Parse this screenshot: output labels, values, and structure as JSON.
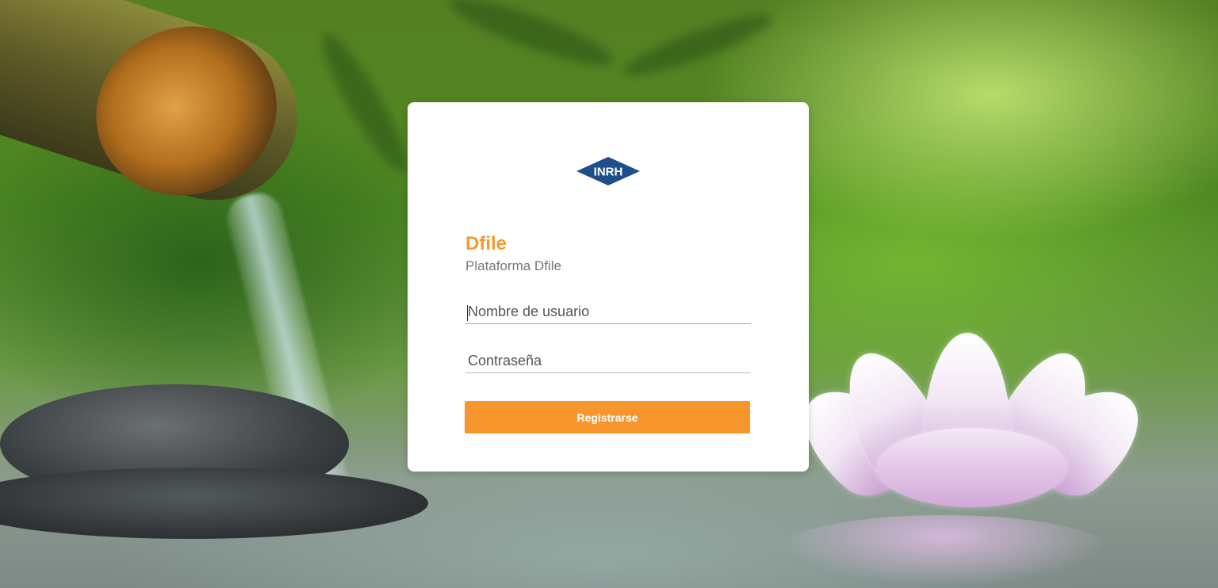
{
  "logo": {
    "text": "INRH",
    "color": "#1f4e8c"
  },
  "login": {
    "title": "Dfile",
    "subtitle": "Plataforma Dfile",
    "username_placeholder": "Nombre de usuario",
    "password_placeholder": "Contraseña",
    "submit_label": "Registrarse"
  },
  "colors": {
    "accent": "#f39a2e",
    "card": "#ffffff"
  }
}
